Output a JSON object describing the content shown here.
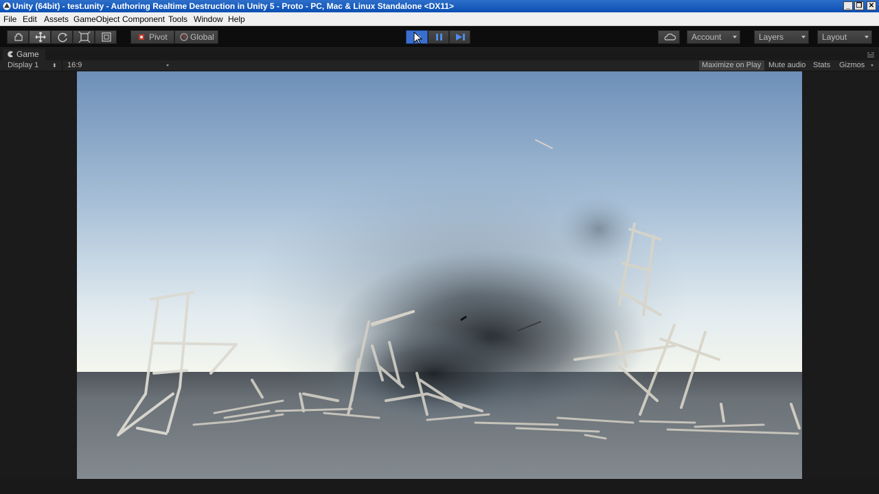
{
  "window": {
    "title": "Unity (64bit) - test.unity - Authoring Realtime Destruction in Unity 5 - Proto - PC, Mac & Linux Standalone <DX11>",
    "controls": [
      "minimize",
      "restore",
      "close"
    ]
  },
  "menu": {
    "items": [
      "File",
      "Edit",
      "Assets",
      "GameObject",
      "Component",
      "Tools",
      "Window",
      "Help"
    ]
  },
  "toolbar": {
    "transform_tools": [
      "hand-tool",
      "move-tool",
      "rotate-tool",
      "scale-tool",
      "rect-tool"
    ],
    "active_tool": "move-tool",
    "pivot_label": "Pivot",
    "space_label": "Global",
    "playback": [
      "play",
      "pause",
      "step"
    ],
    "account_label": "Account",
    "layers_label": "Layers",
    "layout_label": "Layout"
  },
  "game_view": {
    "tab_label": "Game",
    "display_label": "Display 1",
    "aspect_label": "16:9",
    "maximize_label": "Maximize on Play",
    "mute_label": "Mute audio",
    "stats_label": "Stats",
    "gizmos_label": "Gizmos"
  },
  "colors": {
    "play_active": "#3a6fd0",
    "toolbar_bg": "#0d0d0d",
    "sky_top": "#6f90b8",
    "horizon": "#eef2e8",
    "ground": "#6b7278"
  }
}
